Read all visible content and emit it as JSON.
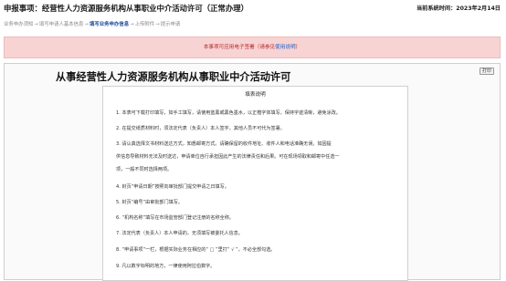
{
  "header": {
    "title": "申报事项：经营性人力资源服务机构从事职业中介活动许可（正常办理）",
    "server_time": "当前系统时间：2023年2月14日"
  },
  "breadcrumb": {
    "steps": [
      {
        "label": "业务申办须知"
      },
      {
        "label": "填写申请人基本信息"
      },
      {
        "label": "填写业务申办信息"
      },
      {
        "label": "上传附件"
      },
      {
        "label": "提示申请"
      }
    ],
    "arrow": "→"
  },
  "alert": {
    "text": "本事项可应用电子签署（请参见",
    "link": "使用说明",
    "suffix": "）"
  },
  "document": {
    "title": "从事经营性人力资源服务机构从事职业中介活动许可",
    "print_label": "打印",
    "notice_title": "填表说明",
    "items": [
      "1. 本表可下载打印填写，如手工填写，请使用蓝黑或黑色墨水，以正楷字体填写，保持字迹清晰，避免涂改。",
      "2. 在提交纸质材料时，须法定代表（负责人）本人签字，其他人员不可代为签署。",
      "3. 请认真选择文书材料送达方式，知悉邮寄方式。请确保留的收件地址、收件人和电话准确无误。如因提",
      "供信息导致材料无法及时送达，申请单位自行承担因此产生的法律责任和后果。可在现场领取和邮寄中任选一",
      "项，一般不同时选择两项。",
      "4. 封页“申请日期”按照向审批部门提交申请之日填写。",
      "5. 封页“编号”由审批部门填写。",
      "6. “机构名称”填写在市场监管部门登记注册的名称全称。",
      "7. 法定代表（负责人）本人申请的，无须填写被委托人信息。",
      "8. “申请事项”一栏，根据实际业务在相应的“ □ ”里打“ √ ”，不必全部勾选。",
      "9. 凡以数字标明的地方，一律使用阿拉伯数字。"
    ]
  }
}
